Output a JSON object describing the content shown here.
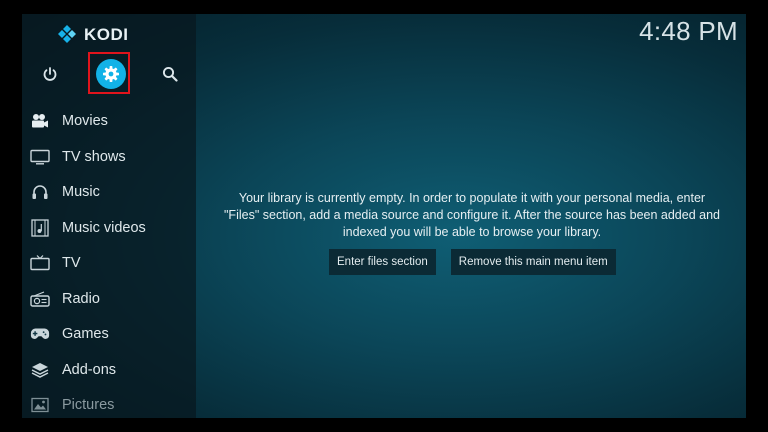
{
  "app": {
    "name": "KODI",
    "accent_color": "#12b2e7",
    "highlight_color": "#e0141c"
  },
  "clock": "4:48 PM",
  "top_icons": [
    "power-icon",
    "settings-icon",
    "search-icon"
  ],
  "menu": {
    "items": [
      {
        "label": "Movies",
        "icon": "movies-icon"
      },
      {
        "label": "TV shows",
        "icon": "tv-shows-icon"
      },
      {
        "label": "Music",
        "icon": "music-icon"
      },
      {
        "label": "Music videos",
        "icon": "music-videos-icon"
      },
      {
        "label": "TV",
        "icon": "tv-icon"
      },
      {
        "label": "Radio",
        "icon": "radio-icon"
      },
      {
        "label": "Games",
        "icon": "games-icon"
      },
      {
        "label": "Add-ons",
        "icon": "add-ons-icon"
      },
      {
        "label": "Pictures",
        "icon": "pictures-icon"
      }
    ]
  },
  "library": {
    "message_line1": "Your library is currently empty. In order to populate it with your personal media, enter",
    "message_line2": "\"Files\" section, add a media source and configure it. After the source has been added and",
    "message_line3": "indexed you will be able to browse your library.",
    "enter_files_label": "Enter files section",
    "remove_label": "Remove this main menu item"
  }
}
